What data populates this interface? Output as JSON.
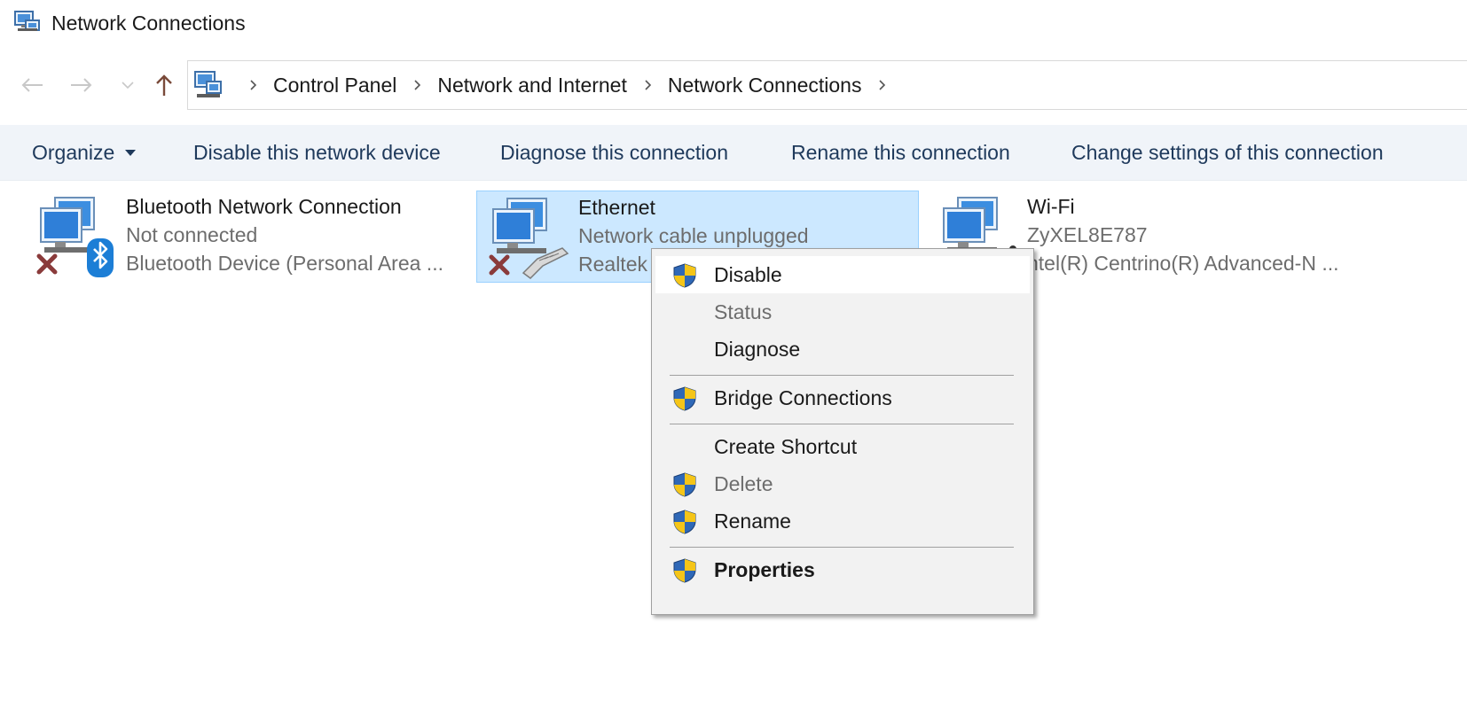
{
  "window": {
    "title": "Network Connections"
  },
  "breadcrumb": {
    "items": [
      "Control Panel",
      "Network and Internet",
      "Network Connections"
    ]
  },
  "toolbar": {
    "organize": "Organize",
    "disable_device": "Disable this network device",
    "diagnose": "Diagnose this connection",
    "rename": "Rename this connection",
    "change_settings": "Change settings of this connection"
  },
  "connections": [
    {
      "name": "Bluetooth Network Connection",
      "status": "Not connected",
      "device": "Bluetooth Device (Personal Area ...",
      "icon": "bluetooth-network-icon"
    },
    {
      "name": "Ethernet",
      "status": "Network cable unplugged",
      "device": "Realtek",
      "icon": "ethernet-network-icon",
      "selected": true
    },
    {
      "name": "Wi-Fi",
      "status": "ZyXEL8E787",
      "device": "ntel(R) Centrino(R) Advanced-N ...",
      "icon": "wifi-network-icon"
    }
  ],
  "context_menu": {
    "items": [
      {
        "label": "Disable",
        "shield": true,
        "hover": true
      },
      {
        "label": "Status",
        "disabled": true
      },
      {
        "label": "Diagnose"
      },
      {
        "label": "Bridge Connections",
        "shield": true
      },
      {
        "label": "Create Shortcut"
      },
      {
        "label": "Delete",
        "shield": true,
        "disabled": true
      },
      {
        "label": "Rename",
        "shield": true
      },
      {
        "label": "Properties",
        "shield": true,
        "bold": true
      }
    ]
  },
  "colors": {
    "command_text": "#1e395b",
    "command_bar": "#f0f4f9",
    "selection": "#cce8ff",
    "selection_border": "#99d1ff",
    "menu_bg": "#f2f2f2",
    "secondary_text": "#6d6d6d",
    "shield_blue": "#2f68b7",
    "shield_yellow": "#f5c518"
  }
}
